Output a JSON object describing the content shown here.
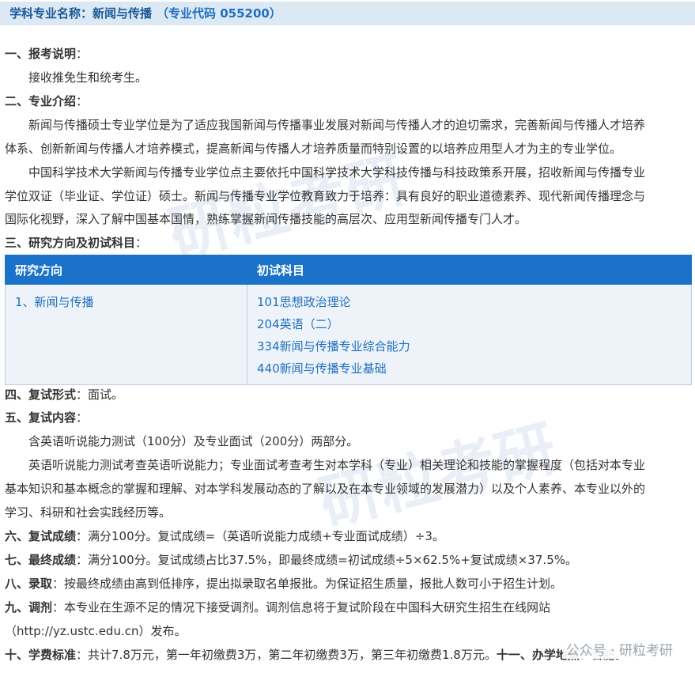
{
  "header": {
    "label": "学科专业名称：新闻与传播",
    "code": "（专业代码  055200）"
  },
  "s1": {
    "title": "一、报考说明",
    "sep": "：",
    "text": "接收推免生和统考生。"
  },
  "s2": {
    "title": "二、专业介绍",
    "sep": "：",
    "p1_l1": "新闻与传播硕士专业学位是为了适应我国新闻与传播事业发展对新闻与传播人才的迫切需求，完善新闻与传播人才培养",
    "p1_l2": "体系、创新新闻与传播人才培养模式，提高新闻与传播人才培养质量而特别设置的以培养应用型人才为主的专业学位。",
    "p2_l1": "中国科学技术大学新闻与传播专业学位点主要依托中国科学技术大学科技传播与科技政策系开展，招收新闻与传播专业",
    "p2_l2": "学位双证（毕业证、学位证）硕士。新闻与传播专业学位教育致力于培养：具有良好的职业道德素养、现代新闻传播理念与",
    "p2_l3": "国际化视野，深入了解中国基本国情，熟练掌握新闻传播技能的高层次、应用型新闻传播专门人才。"
  },
  "s3": {
    "title": "三、研究方向及初试科目",
    "sep": "：",
    "table": {
      "col1": "研究方向",
      "col2": "初试科目",
      "direction": "1、新闻与传播",
      "subjects": [
        "101思想政治理论",
        "204英语（二）",
        "334新闻与传播专业综合能力",
        "440新闻与传播专业基础"
      ]
    }
  },
  "s4": {
    "title": "四、复试形式",
    "text": "：面试。"
  },
  "s5": {
    "title": "五、复试内容",
    "sep": "：",
    "p1": "含英语听说能力测试（100分）及专业面试（200分）两部分。",
    "p2_l1": "英语听说能力测试考查英语听说能力；专业面试考查考生对本学科（专业）相关理论和技能的掌握程度（包括对本专业",
    "p2_l2": "基本知识和基本概念的掌握和理解、对本学科发展动态的了解以及在本专业领域的发展潜力）以及个人素养、本专业以外的",
    "p2_l3": "学习、科研和社会实践经历等。"
  },
  "s6": {
    "title": "六、复试成绩",
    "text": "：满分100分。复试成绩=（英语听说能力成绩+专业面试成绩）÷3。"
  },
  "s7": {
    "title": "七、最终成绩",
    "text": "：满分100分。复试成绩占比37.5%，即最终成绩=初试成绩÷5×62.5%+复试成绩×37.5%。"
  },
  "s8": {
    "title": "八、录取",
    "text": "：按最终成绩由高到低排序，提出拟录取名单报批。为保证招生质量，报批人数可小于招生计划。"
  },
  "s9": {
    "title": "九、调剂",
    "text": "：本专业在生源不足的情况下接受调剂。调剂信息将于复试阶段在中国科大研究生招生在线网站",
    "text2": "（http://yz.ustc.edu.cn）发布。"
  },
  "s10": {
    "title": "十、学费标准",
    "text": "：共计7.8万元，第一年初缴费3万，第二年初缴费3万，第三年初缴费1.8万元。",
    "title2": "十一、办学地点",
    "text2": "：合肥。"
  },
  "footer": {
    "source": "公众号 · 研粒考研"
  },
  "watermark": {
    "text1": "研粒考研",
    "text2": "研粒考研"
  }
}
